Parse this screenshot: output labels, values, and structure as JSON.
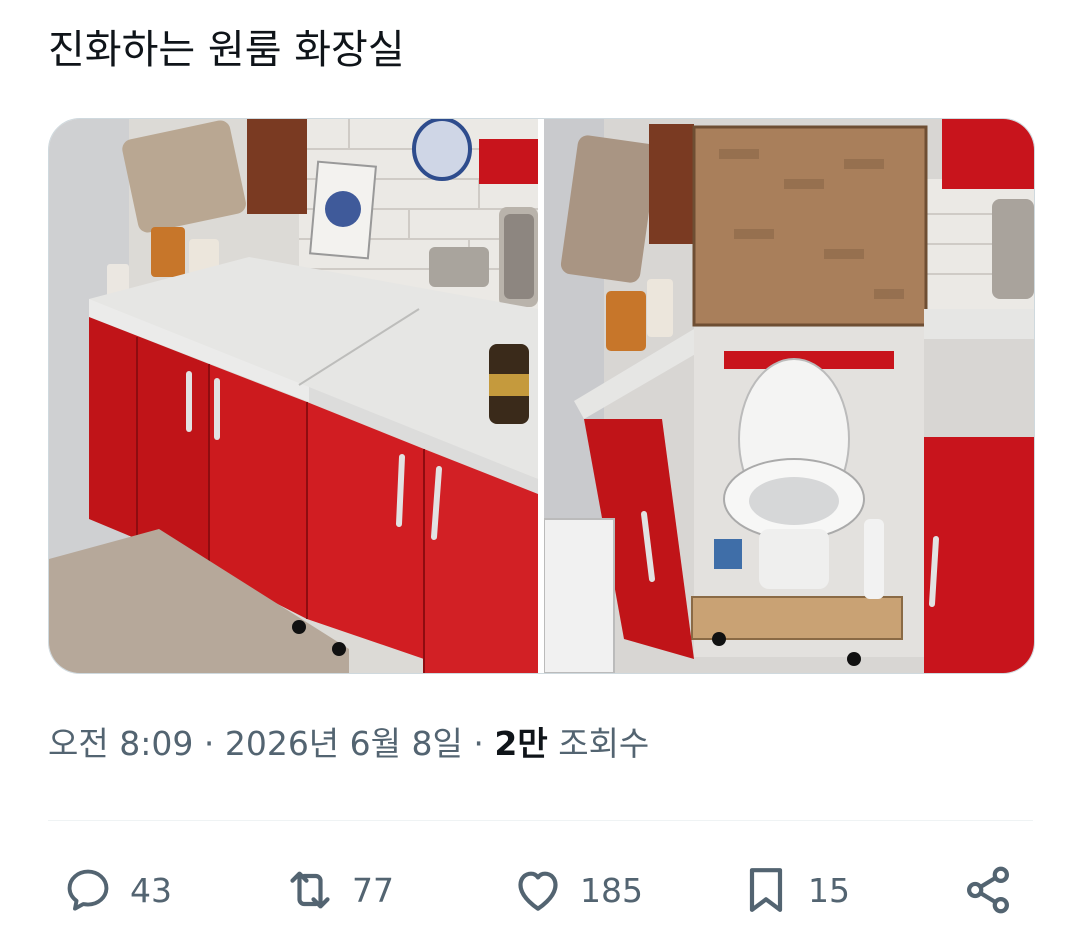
{
  "tweet": {
    "text": "진화하는 원룸 화장실"
  },
  "media": {
    "images": [
      {
        "description": "red kitchen cabinets with white countertop"
      },
      {
        "description": "kitchen cabinet opened revealing a toilet underneath"
      }
    ]
  },
  "meta": {
    "time": "오전 8:09",
    "separator": "·",
    "date": "2026년 6월 8일",
    "views_count": "2만",
    "views_label": "조회수"
  },
  "actions": {
    "replies": "43",
    "retweets": "77",
    "likes": "185",
    "bookmarks": "15"
  },
  "icons": {
    "reply": "speech-bubble-icon",
    "retweet": "retweet-arrows-icon",
    "like": "heart-icon",
    "bookmark": "bookmark-icon",
    "share": "share-nodes-icon"
  },
  "colors": {
    "text": "#0f1419",
    "secondary": "#536471",
    "cabinet_red": "#c8141c"
  }
}
